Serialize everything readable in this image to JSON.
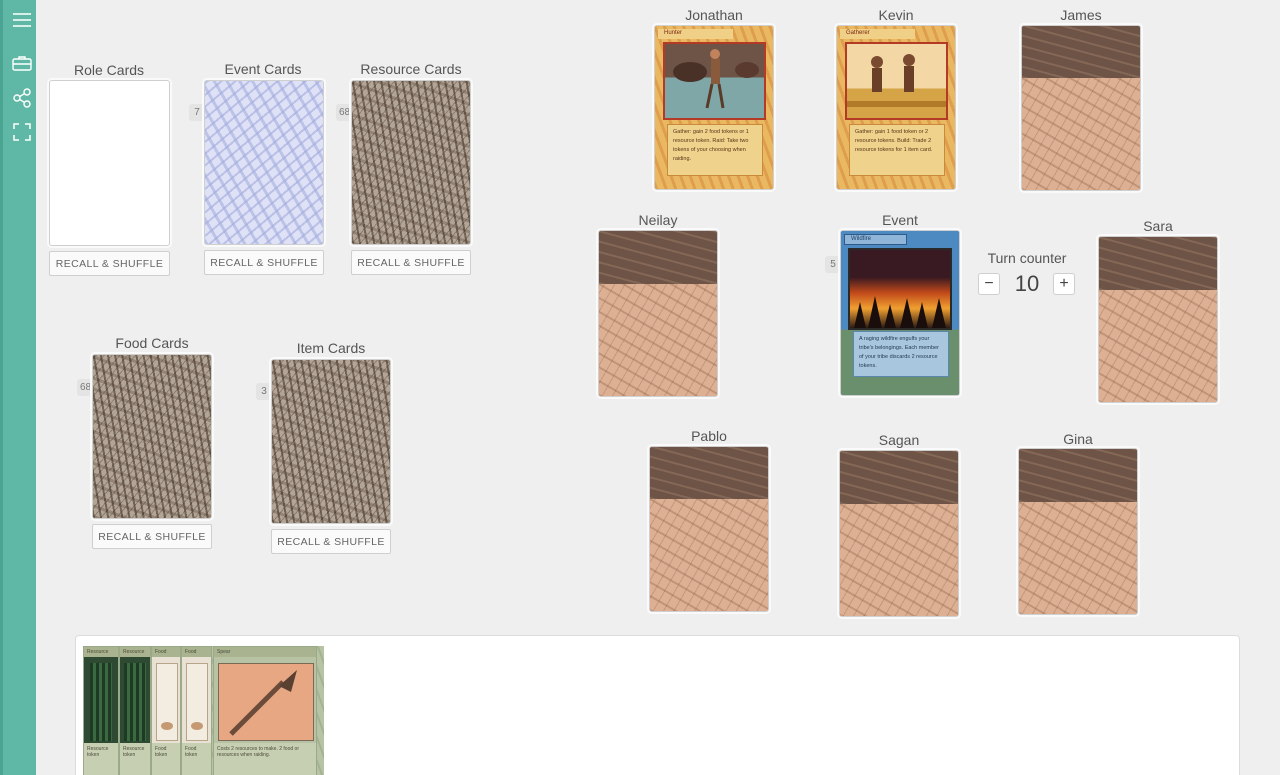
{
  "sidebar": {
    "items": [
      {
        "name": "menu-icon"
      },
      {
        "name": "briefcase-icon"
      },
      {
        "name": "share-icon"
      },
      {
        "name": "fullscreen-icon"
      }
    ]
  },
  "decks": {
    "role": {
      "label": "Role Cards",
      "button": "RECALL & SHUFFLE"
    },
    "event": {
      "label": "Event Cards",
      "count": "7",
      "button": "RECALL & SHUFFLE"
    },
    "resource": {
      "label": "Resource Cards",
      "count": "68",
      "button": "RECALL & SHUFFLE"
    },
    "food": {
      "label": "Food Cards",
      "count": "68",
      "button": "RECALL & SHUFFLE"
    },
    "item": {
      "label": "Item Cards",
      "count": "3",
      "button": "RECALL & SHUFFLE"
    }
  },
  "players": {
    "jonathan": {
      "name": "Jonathan",
      "role_title": "Hunter",
      "role_text": "Gather: gain 2 food tokens or 1 resource token. Raid: Take two tokens of your choosing when raiding."
    },
    "kevin": {
      "name": "Kevin",
      "role_title": "Gatherer",
      "role_text": "Gather: gain 1 food token or 2 resource tokens. Build: Trade 2 resource tokens for 1 item card."
    },
    "james": {
      "name": "James"
    },
    "neilay": {
      "name": "Neilay"
    },
    "sara": {
      "name": "Sara"
    },
    "pablo": {
      "name": "Pablo"
    },
    "sagan": {
      "name": "Sagan"
    },
    "gina": {
      "name": "Gina"
    }
  },
  "event_slot": {
    "label": "Event",
    "count": "5",
    "card_title": "Wildfire",
    "card_text": "A raging wildfire engulfs your tribe's belongings. Each member of your tribe discards 2 resource tokens."
  },
  "turn_counter": {
    "label": "Turn counter",
    "value": "10",
    "minus": "−",
    "plus": "+"
  },
  "hand": {
    "cards": [
      {
        "title": "Resource",
        "text": "Resource token"
      },
      {
        "title": "Resource",
        "text": "Resource token"
      },
      {
        "title": "Food",
        "text": "Food token"
      },
      {
        "title": "Food",
        "text": "Food token"
      },
      {
        "title": "Spear",
        "text": "Costs 2 resources to make. 2 food or resources when raiding."
      }
    ]
  },
  "colors": {
    "sidebar": "#5fb8a6",
    "background": "#efefef",
    "card_back_top": "#6e5447",
    "card_back_bottom": "#ddb093"
  }
}
